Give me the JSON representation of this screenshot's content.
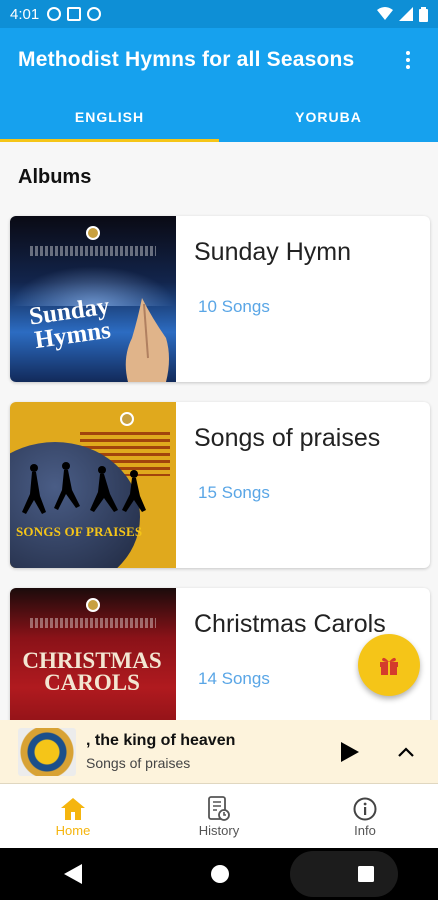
{
  "status_bar": {
    "time": "4:01"
  },
  "app_bar": {
    "title": "Methodist Hymns for all Seasons"
  },
  "tabs": [
    {
      "label": "ENGLISH",
      "active": true
    },
    {
      "label": "YORUBA",
      "active": false
    }
  ],
  "albums": {
    "section_title": "Albums",
    "items": [
      {
        "title": "Sunday Hymn",
        "count": "10 Songs",
        "cover_text": "Sunday Hymns"
      },
      {
        "title": "Songs of praises",
        "count": "15 Songs",
        "cover_text": "SONGS OF PRAISES"
      },
      {
        "title": "Christmas Carols",
        "count": "14 Songs",
        "cover_text": "CHRISTMAS CAROLS"
      }
    ]
  },
  "player": {
    "now_playing": ", the king of heaven",
    "album": "Songs of praises"
  },
  "bottom_nav": [
    {
      "label": "Home",
      "icon": "home-icon",
      "active": true
    },
    {
      "label": "History",
      "icon": "history-icon",
      "active": false
    },
    {
      "label": "Info",
      "icon": "info-icon",
      "active": false
    }
  ],
  "colors": {
    "primary": "#16a1ee",
    "accent": "#f5c518",
    "song_count": "#5aa6e6",
    "player_bg": "#fdf3dc"
  }
}
